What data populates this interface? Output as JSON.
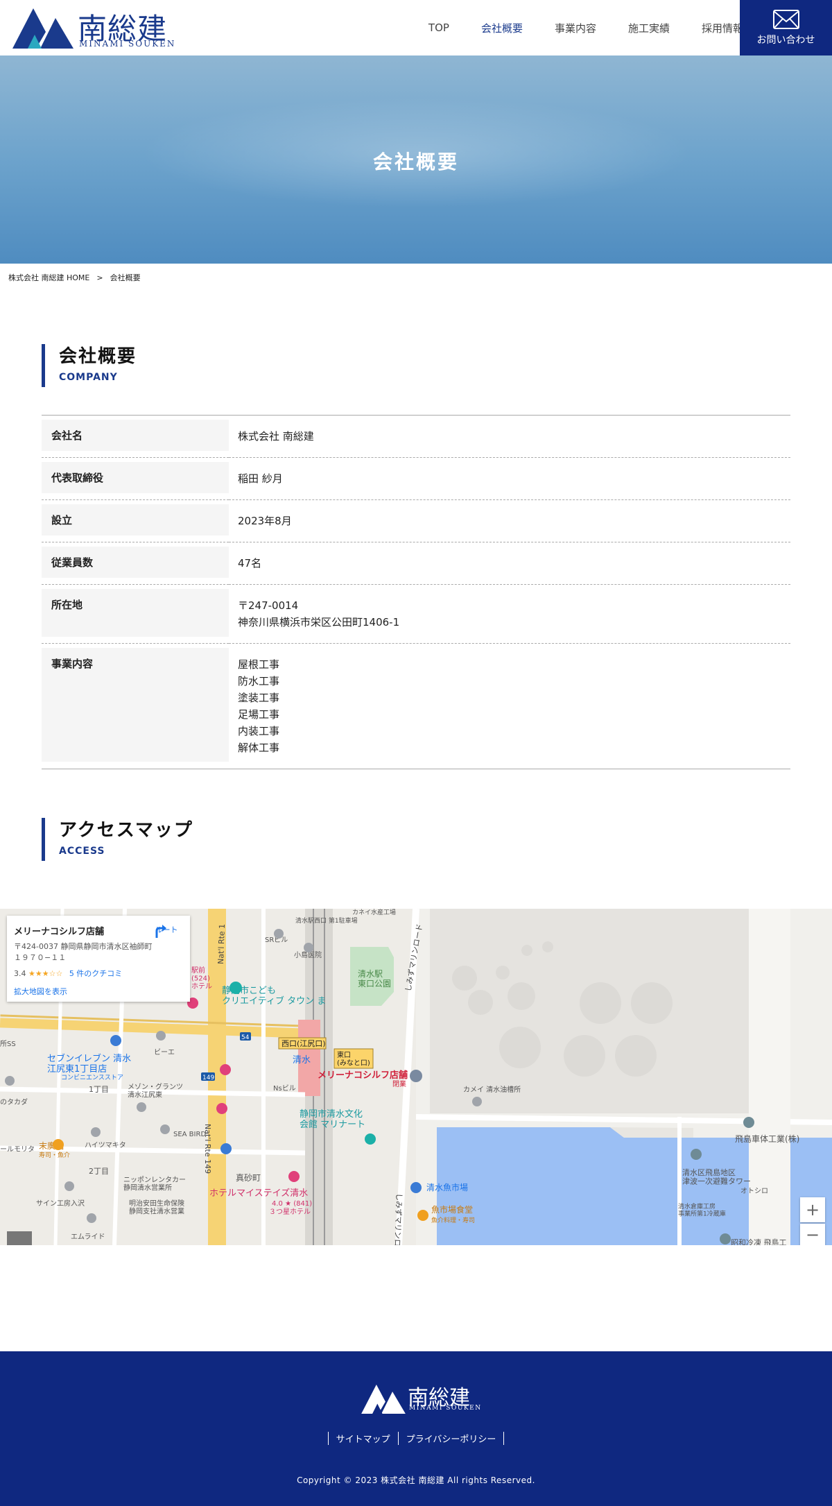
{
  "header": {
    "logo_main": "南総建",
    "logo_sub": "MINAMI SOUKEN",
    "nav": [
      "TOP",
      "会社概要",
      "事業内容",
      "施工実績",
      "採用情報"
    ],
    "contact_label": "お問い合わせ"
  },
  "hero": {
    "title": "会社概要"
  },
  "breadcrumb": {
    "home": "株式会社 南総建 HOME",
    "sep": ">",
    "current": "会社概要"
  },
  "company": {
    "heading": "会社概要",
    "heading_en": "COMPANY",
    "rows": [
      {
        "label": "会社名",
        "lines": [
          "株式会社 南総建"
        ]
      },
      {
        "label": "代表取締役",
        "lines": [
          "稲田 紗月"
        ]
      },
      {
        "label": "設立",
        "lines": [
          "2023年8月"
        ]
      },
      {
        "label": "従業員数",
        "lines": [
          "47名"
        ]
      },
      {
        "label": "所在地",
        "lines": [
          "〒247-0014",
          "神奈川県横浜市栄区公田町1406-1"
        ]
      },
      {
        "label": "事業内容",
        "lines": [
          "屋根工事",
          "防水工事",
          "塗装工事",
          "足場工事",
          "内装工事",
          "解体工事"
        ]
      }
    ]
  },
  "access": {
    "heading": "アクセスマップ",
    "heading_en": "ACCESS"
  },
  "map": {
    "card": {
      "name": "メリーナコシルフ店舗",
      "address": "〒424-0037 静岡県静岡市清水区袖師町１９７０−１１",
      "rating": "3.4",
      "stars": "★★★☆☆",
      "reviews": "5 件のクチコミ",
      "big_map": "拡大地図を表示",
      "route": "ルート"
    },
    "labels": {
      "marker": "メリーナコシルフ店舗",
      "marker_sub": "閉業",
      "shimizu": "清水",
      "east_exit": "東口\n(みなと口)",
      "west_exit": "西口(江尻口)",
      "park": "清水駅\n東口公園",
      "kodomo": "静岡市こども\nクリエイティブ タウン ま",
      "seven": "セブンイレブン 清水\n江尻東1丁目店",
      "seven_sub": "コンビニエンスストア",
      "bunka": "静岡市清水文化\n会館 マリナート",
      "hotel": "ホテルマイステイズ清水",
      "hotel_rating": "4.0 ★ (841)",
      "hotel_type": "３つ星ホテル",
      "uoichiba": "清水魚市場",
      "shokudo": "魚市場食堂",
      "shokudo_sub": "魚介料理・寿司",
      "tobishima": "飛島車体工業(株)",
      "shimizuku": "清水区飛島地区\n津波一次避難タワー",
      "oto": "オトシロ",
      "showa": "昭和冷凍 飛島工",
      "kamei": "カメイ 清水油槽所",
      "sr": "SRビル",
      "kojima": "小島医院",
      "ns": "Nsビル",
      "bina": "ビーエ",
      "itchome": "1丁目",
      "nichome": "2丁目",
      "manasago": "真砂町",
      "seabird": "SEA BIRD",
      "haitsu": "ハイツマキタ",
      "sushi": "末廣鮨",
      "sushi_sub": "寿司・魚介",
      "rentacar": "ニッポンレンタカー\n静岡清水営業所",
      "meiji": "明治安田生命保険\n静岡支社清水営業",
      "sain": "サイン工房入沢",
      "emuraido": "エムライド",
      "rte1": "Nat'l Rte 1",
      "rte149": "Nat'l Rte 149",
      "marine_road": "しみずマリンロード",
      "marine_road2": "しみずマリンロード",
      "station_west": "清水駅西口 第1駐車場",
      "kanei": "カネイ水産工場",
      "meson": "メゾン・グランツ\n清水江尻東",
      "route54": "54",
      "route149": "149",
      "ekimae": "駅前\n(524)\nホテル",
      "morita": "ールモリタ",
      "takada": "のタカダ",
      "ss": "所SS",
      "yashiro": "清水倉庫工房\n事業所第1冷蔵庫"
    },
    "zoom_in": "+",
    "zoom_out": "−"
  },
  "footer": {
    "logo_main": "南総建",
    "logo_sub": "MINAMI SOUKEN",
    "links": [
      "サイトマップ",
      "プライバシーポリシー"
    ],
    "copyright": "Copyright © 2023 株式会社 南総建 All rights Reserved."
  },
  "colors": {
    "navy": "#0f2880",
    "brand_blue": "#1a3a8c",
    "teal": "#2aa8c0"
  }
}
